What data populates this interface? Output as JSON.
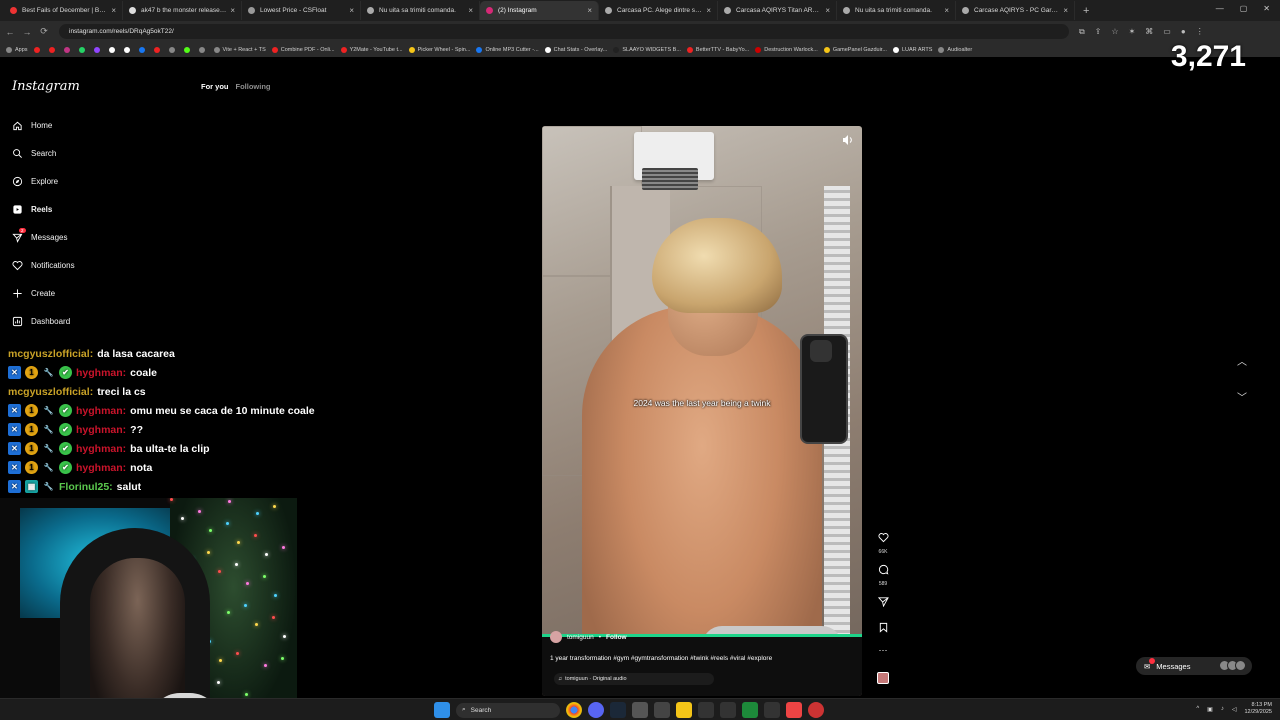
{
  "browser": {
    "tabs": [
      {
        "title": "Best Fails of December | Best o",
        "color": "#e33"
      },
      {
        "title": "ak47 b the monster release da",
        "color": "#ddd"
      },
      {
        "title": "Lowest Price - CSFloat",
        "color": "#999"
      },
      {
        "title": "Nu uita sa trimiti comanda.",
        "color": "#aaa"
      },
      {
        "title": "(2) Instagram",
        "color": "#d62976",
        "active": true
      },
      {
        "title": "Carcasa PC. Alege dintre sute c",
        "color": "#aaa"
      },
      {
        "title": "Carcasa AQIRYS Titan ARGB W",
        "color": "#aaa"
      },
      {
        "title": "Nu uita sa trimiti comanda.",
        "color": "#aaa"
      },
      {
        "title": "Carcase AQIRYS - PC Garage",
        "color": "#aaa"
      }
    ],
    "new_tab_icon": "plus-icon",
    "url": "instagram.com/reels/DRqAg5okT22/",
    "bookmarks": [
      {
        "label": "Apps",
        "color": "#888"
      },
      {
        "label": "",
        "color": "#e22"
      },
      {
        "label": "",
        "color": "#e22"
      },
      {
        "label": "",
        "color": "#c13584"
      },
      {
        "label": "",
        "color": "#25d366"
      },
      {
        "label": "",
        "color": "#9146ff"
      },
      {
        "label": "",
        "color": "#fff"
      },
      {
        "label": "",
        "color": "#fff"
      },
      {
        "label": "",
        "color": "#1877f2"
      },
      {
        "label": "",
        "color": "#e22"
      },
      {
        "label": "",
        "color": "#888"
      },
      {
        "label": "",
        "color": "#53fc18"
      },
      {
        "label": "",
        "color": "#888"
      },
      {
        "label": "Vite + React + TS",
        "color": "#888"
      },
      {
        "label": "Combine PDF - Onli...",
        "color": "#e22"
      },
      {
        "label": "Y2Mate - YouTube t...",
        "color": "#e22"
      },
      {
        "label": "Picker Wheel - Spin...",
        "color": "#f5c518"
      },
      {
        "label": "Online MP3 Cutter -...",
        "color": "#1877f2"
      },
      {
        "label": "Chat Stats - Overlay...",
        "color": "#fff"
      },
      {
        "label": "SLAAYO WIDGETS B...",
        "color": "#222"
      },
      {
        "label": "BetterTTV - BabyYo...",
        "color": "#e22"
      },
      {
        "label": "Destruction Warlock...",
        "color": "#c00"
      },
      {
        "label": "GamePanel Gazduir...",
        "color": "#f5c518"
      },
      {
        "label": "LUAR ARTS",
        "color": "#fff"
      },
      {
        "label": "Audioalter",
        "color": "#888"
      }
    ]
  },
  "stream": {
    "viewer_count": "3,271"
  },
  "instagram": {
    "logo": "Instagram",
    "nav": [
      {
        "label": "Home",
        "icon": "home-icon",
        "bold": false
      },
      {
        "label": "Search",
        "icon": "search-icon",
        "bold": false
      },
      {
        "label": "Explore",
        "icon": "compass-icon",
        "bold": false
      },
      {
        "label": "Reels",
        "icon": "reels-icon",
        "bold": true
      },
      {
        "label": "Messages",
        "icon": "messenger-icon",
        "bold": false,
        "badge": "2"
      },
      {
        "label": "Notifications",
        "icon": "heart-icon",
        "bold": false
      },
      {
        "label": "Create",
        "icon": "plus-icon",
        "bold": false
      },
      {
        "label": "Dashboard",
        "icon": "dashboard-icon",
        "bold": false
      }
    ],
    "feed_tabs": {
      "active": "For you",
      "inactive": "Following"
    },
    "reel": {
      "overlay_text": "2024 was the last year being a twink",
      "author": "tomiguun",
      "separator": "•",
      "follow_label": "Follow",
      "caption": "1 year transformation #gym #gymtransformation #twink #reels #viral #explore",
      "audio": "tomiguun · Original audio"
    },
    "actions": {
      "likes": "66K",
      "comments": "589"
    },
    "messages_pill": {
      "label": "Messages"
    }
  },
  "chat": [
    {
      "user": "mcgyuszlofficial:",
      "user_class": "u-tan",
      "badges": [],
      "message": "da lasa cacarea"
    },
    {
      "user": "hyghman:",
      "user_class": "u-red",
      "badges": [
        "blue",
        "gold",
        "wrench",
        "green"
      ],
      "message": "coale"
    },
    {
      "user": "mcgyuszlofficial:",
      "user_class": "u-tan",
      "badges": [],
      "message": "treci la cs"
    },
    {
      "user": "hyghman:",
      "user_class": "u-red",
      "badges": [
        "blue",
        "gold",
        "wrench",
        "green"
      ],
      "message": "omu meu se caca de 10 minute coale"
    },
    {
      "user": "hyghman:",
      "user_class": "u-red",
      "badges": [
        "blue",
        "gold",
        "wrench",
        "green"
      ],
      "message": "??"
    },
    {
      "user": "hyghman:",
      "user_class": "u-red",
      "badges": [
        "blue",
        "gold",
        "wrench",
        "green"
      ],
      "message": "ba ulta-te la clip"
    },
    {
      "user": "hyghman:",
      "user_class": "u-red",
      "badges": [
        "blue",
        "gold",
        "wrench",
        "green"
      ],
      "message": "nota"
    },
    {
      "user": "Florinul25:",
      "user_class": "u-green",
      "badges": [
        "blue",
        "cyan",
        "wrench"
      ],
      "message": "salut"
    }
  ],
  "taskbar": {
    "search_label": "Search",
    "time": "8:13 PM",
    "date": "12/29/2025"
  }
}
